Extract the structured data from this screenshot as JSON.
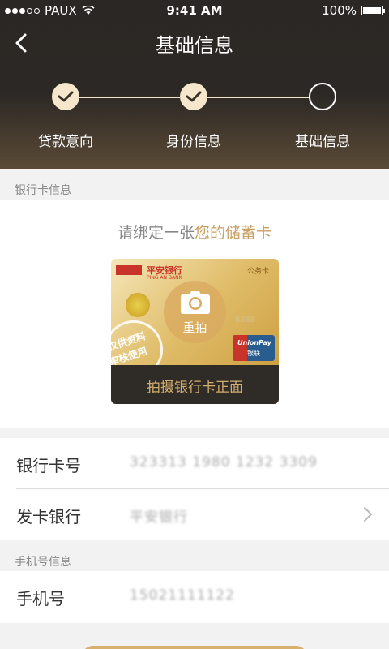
{
  "status_bar": {
    "carrier": "PAUX",
    "time": "9:41 AM",
    "battery_percent": "100%",
    "signal_bars": 5,
    "signal_filled": 3
  },
  "nav": {
    "title": "基础信息",
    "back_icon": "chevron-left-icon"
  },
  "stepper": {
    "steps": [
      {
        "label": "贷款意向",
        "status": "done"
      },
      {
        "label": "身份信息",
        "status": "done"
      },
      {
        "label": "基础信息",
        "status": "current"
      }
    ],
    "colors": {
      "done_fill": "#f6e7cc",
      "line": "#f0e2c8"
    }
  },
  "bank_card_section": {
    "section_label": "银行卡信息",
    "prompt_prefix": "请绑定一张",
    "prompt_highlight": "您的储蓄卡",
    "card": {
      "bank_name": "平安银行",
      "bank_name_en": "PING AN BANK",
      "card_type": "公务卡",
      "number_fragment": "8888",
      "union_pay_text": "UnionPay",
      "union_pay_cn": "银联",
      "stamp_line1": "仅供资料",
      "stamp_line2": "审核使用",
      "retake_label": "重拍",
      "capture_label": "拍摄银行卡正面"
    }
  },
  "card_form": {
    "card_number_label": "银行卡号",
    "card_number_value": "323313 1980 1232 3309",
    "issuing_bank_label": "发卡银行",
    "issuing_bank_value": "平安银行"
  },
  "phone_section": {
    "section_label": "手机号信息",
    "phone_label": "手机号",
    "phone_value": "15021111122"
  },
  "colors": {
    "accent": "#c9a064",
    "header_dark": "#2c2825",
    "button_gold": "#d7b070"
  }
}
